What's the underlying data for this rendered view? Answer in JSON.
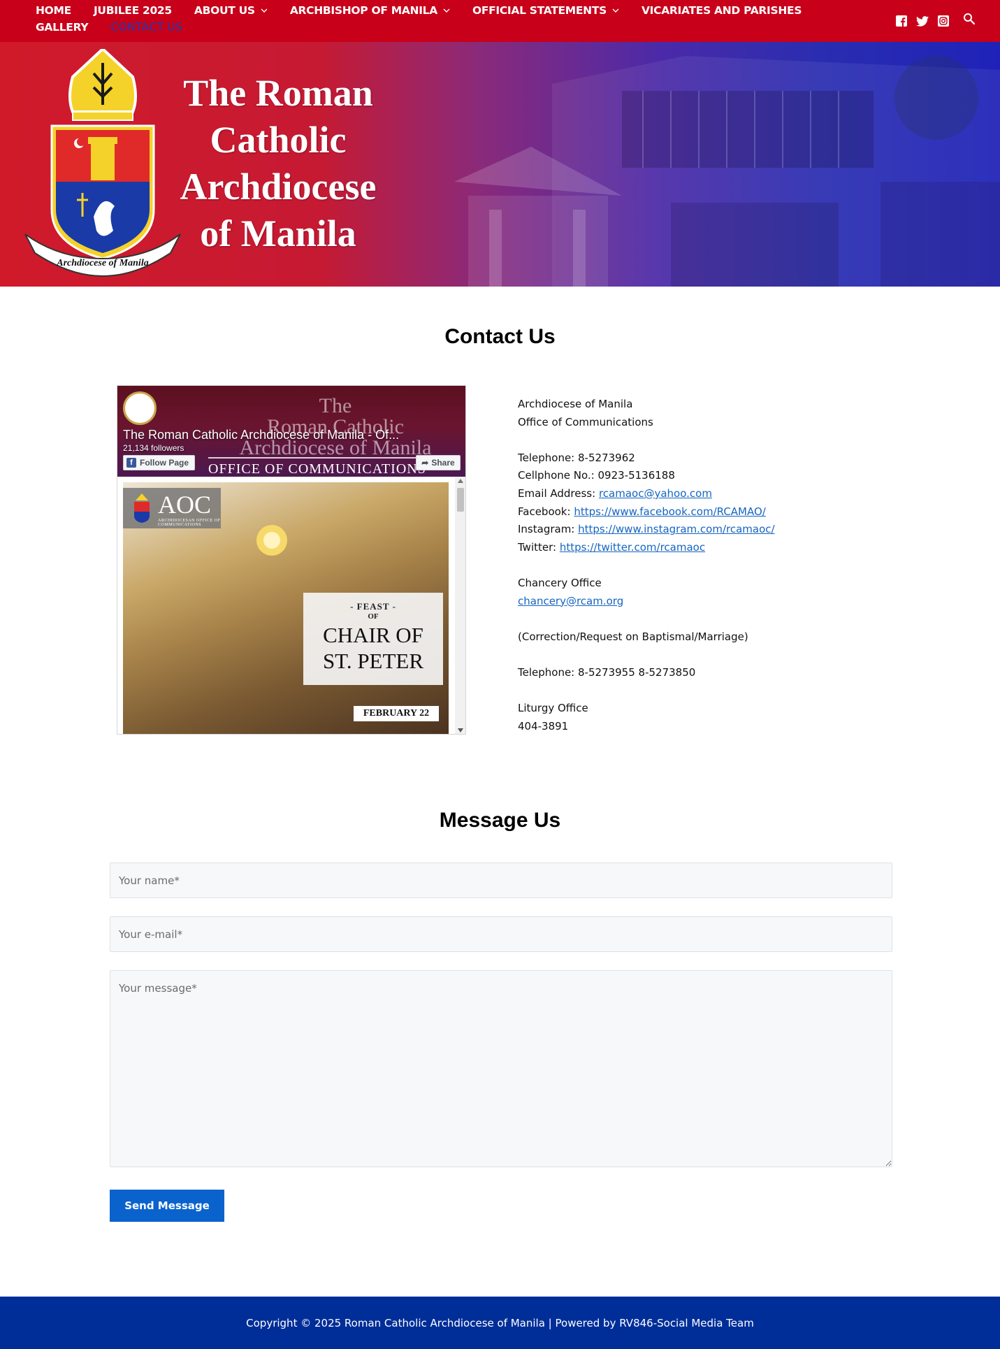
{
  "nav": {
    "items": [
      {
        "label": "HOME",
        "dropdown": false
      },
      {
        "label": "JUBILEE 2025",
        "dropdown": false
      },
      {
        "label": "ABOUT US",
        "dropdown": true
      },
      {
        "label": "ARCHBISHOP OF MANILA",
        "dropdown": true
      },
      {
        "label": "OFFICIAL STATEMENTS",
        "dropdown": true
      },
      {
        "label": "VICARIATES AND PARISHES",
        "dropdown": false
      },
      {
        "label": "GALLERY",
        "dropdown": false
      },
      {
        "label": "CONTACT US",
        "dropdown": false,
        "active": true
      }
    ],
    "social_icons": [
      "facebook-icon",
      "twitter-icon",
      "instagram-icon"
    ],
    "search_icon": "search-icon"
  },
  "hero": {
    "title_lines": [
      "The Roman",
      "Catholic",
      "Archdiocese",
      "of Manila"
    ],
    "crest_ribbon": "Archdiocese of Manila"
  },
  "contact": {
    "title": "Contact Us",
    "facebook_widget": {
      "cover_title_lines": [
        "The",
        "Roman Catholic",
        "Archdiocese of Manila"
      ],
      "cover_subtitle": "OFFICE OF COMMUNICATIONS",
      "page_name": "The Roman Catholic Archdiocese of Manila - Of...",
      "followers": "21,134 followers",
      "follow_label": "Follow Page",
      "share_label": "Share",
      "post": {
        "badge": "AOC",
        "badge_sub": "ARCHDIOCESAN OFFICE OF COMMUNICATIONS",
        "feast_small": "- FEAST -",
        "feast_of": "OF",
        "feast_big_lines": [
          "CHAIR OF",
          "ST. PETER"
        ],
        "date": "FEBRUARY 22"
      }
    },
    "info": {
      "org": "Archdiocese of Manila",
      "office": "Office of Communications",
      "telephone_label": "Telephone: ",
      "telephone": "8-5273962",
      "cellphone_label": "Cellphone No.: ",
      "cellphone": "0923-5136188",
      "email_label": "Email Address: ",
      "email": "rcamaoc@yahoo.com",
      "facebook_label": "Facebook: ",
      "facebook": "https://www.facebook.com/RCAMAO/",
      "instagram_label": "Instagram: ",
      "instagram": "https://www.instagram.com/rcamaoc/",
      "twitter_label": "Twitter: ",
      "twitter": "https://twitter.com/rcamaoc",
      "chancery_title": "Chancery Office",
      "chancery_email": "chancery@rcam.org",
      "correction_note": "(Correction/Request on Baptismal/Marriage)",
      "chancery_telephone": "Telephone: 8-5273955 8-5273850",
      "liturgy_title": "Liturgy Office",
      "liturgy_phone": "404-3891"
    }
  },
  "message": {
    "title": "Message Us",
    "name_placeholder": "Your name*",
    "email_placeholder": "Your e-mail*",
    "message_placeholder": "Your message*",
    "send_label": "Send Message"
  },
  "footer": {
    "text": "Copyright © 2025 Roman Catholic Archdiocese of Manila | Powered by RV846-Social Media Team"
  },
  "colors": {
    "nav_bg": "#c8001a",
    "active_link": "#1a3bb5",
    "link": "#1565c0",
    "button": "#0a63cc",
    "footer_bg": "#002e99"
  }
}
